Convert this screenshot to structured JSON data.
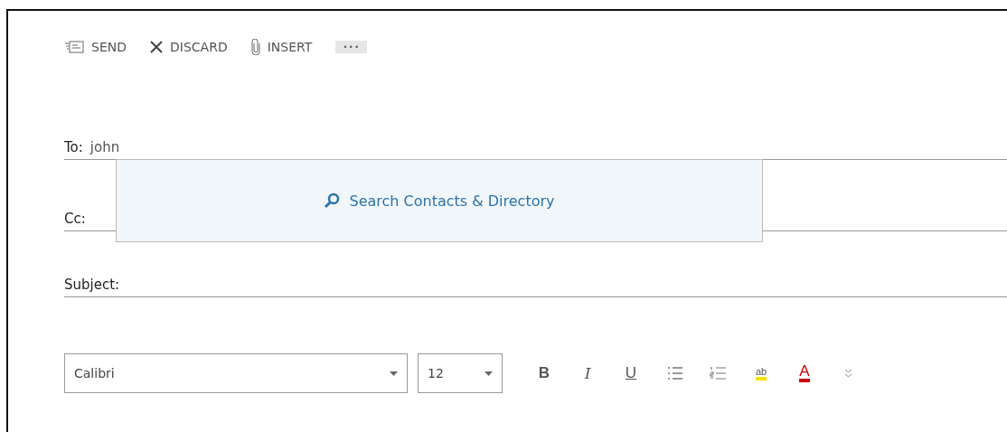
{
  "toolbar": [
    {
      "kind": "send",
      "label": "SEND"
    },
    {
      "kind": "discard",
      "label": "DISCARD"
    },
    {
      "kind": "insert",
      "label": "INSERT"
    },
    {
      "kind": "more",
      "label": "•••"
    }
  ],
  "to": {
    "label": "To:",
    "value": "john"
  },
  "cc": {
    "label": "Cc:"
  },
  "suggestion": {
    "label": "Search Contacts & Directory"
  },
  "subject": {
    "label": "Subject:"
  },
  "format": {
    "font": "Calibri",
    "size": "12",
    "buttons": [
      {
        "kind": "bold",
        "label": "B"
      },
      {
        "kind": "italic",
        "label": "I"
      },
      {
        "kind": "underline",
        "label": "U"
      },
      {
        "kind": "bullets"
      },
      {
        "kind": "numbering"
      },
      {
        "kind": "highlight",
        "label": "ab"
      },
      {
        "kind": "fontcolor",
        "label": "A"
      },
      {
        "kind": "expand"
      }
    ]
  }
}
